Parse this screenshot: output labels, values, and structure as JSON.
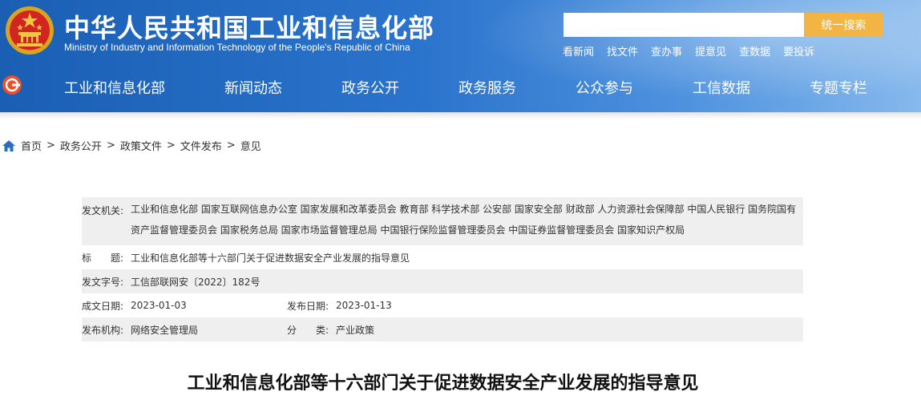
{
  "header": {
    "site_title": "中华人民共和国工业和信息化部",
    "site_subtitle": "Ministry of Industry and Information Technology of the People's Republic of China",
    "search": {
      "placeholder": "",
      "button_label": "统一搜索"
    },
    "quick_links": [
      "看新闻",
      "找文件",
      "查办事",
      "提意见",
      "查数据",
      "要投诉"
    ],
    "nav": [
      "工业和信息化部",
      "新闻动态",
      "政务公开",
      "政务服务",
      "公众参与",
      "工信数据",
      "专题专栏"
    ]
  },
  "breadcrumb": {
    "items": [
      "首页",
      "政务公开",
      "政策文件",
      "文件发布",
      "意见"
    ],
    "separator": ">"
  },
  "meta": {
    "issuer_label": "发文机关:",
    "issuer": "工业和信息化部 国家互联网信息办公室 国家发展和改革委员会 教育部 科学技术部 公安部 国家安全部 财政部 人力资源社会保障部 中国人民银行 国务院国有资产监督管理委员会 国家税务总局 国家市场监督管理总局 中国银行保险监督管理委员会 中国证券监督管理委员会 国家知识产权局",
    "title_label": "标　　题:",
    "title": "工业和信息化部等十六部门关于促进数据安全产业发展的指导意见",
    "doc_no_label": "发文字号:",
    "doc_no": "工信部联网安〔2022〕182号",
    "written_date_label": "成文日期:",
    "written_date": "2023-01-03",
    "publish_date_label": "发布日期:",
    "publish_date": "2023-01-13",
    "publisher_label": "发布机构:",
    "publisher": "网络安全管理局",
    "category_label": "分　　类:",
    "category": "产业政策"
  },
  "article": {
    "title": "工业和信息化部等十六部门关于促进数据安全产业发展的指导意见"
  },
  "colors": {
    "header_blue": "#1a5fb4",
    "search_button": "#f2b544",
    "meta_row_gray": "#efefef"
  },
  "icons": [
    "national-emblem-icon",
    "home-icon",
    "ministry-logo-icon"
  ]
}
